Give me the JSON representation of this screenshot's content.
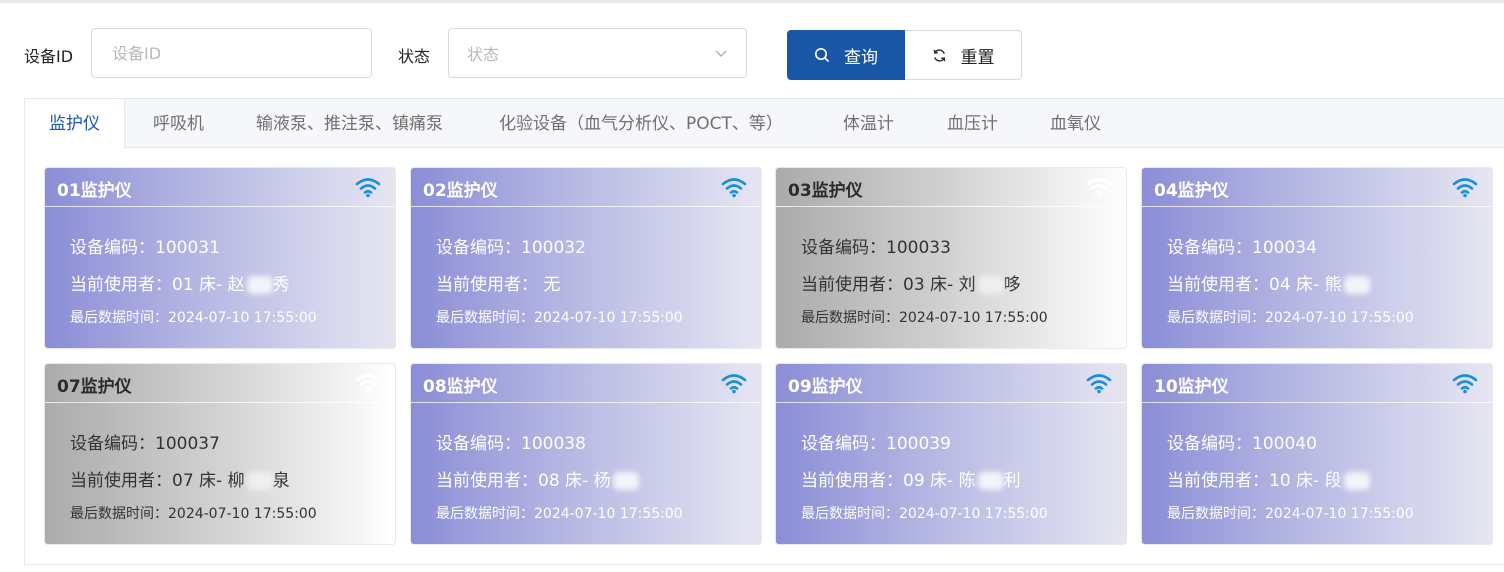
{
  "filters": {
    "device_id_label": "设备ID",
    "device_id_placeholder": "设备ID",
    "device_id_value": "",
    "status_label": "状态",
    "status_placeholder": "状态",
    "query_label": "查询",
    "reset_label": "重置"
  },
  "tabs": [
    {
      "label": "监护仪"
    },
    {
      "label": "呼吸机"
    },
    {
      "label": "输液泵、推注泵、镇痛泵"
    },
    {
      "label": "化验设备（血气分析仪、POCT、等）"
    },
    {
      "label": "体温计"
    },
    {
      "label": "血压计"
    },
    {
      "label": "血氧仪"
    }
  ],
  "active_tab": 0,
  "colors": {
    "primary": "#1a56a6",
    "wifi_online": "#1a8fd8",
    "wifi_offline": "#ffffff"
  },
  "cards": [
    {
      "title": "01监护仪",
      "status": "online",
      "code_line": "设备编码：100031",
      "user_line": "当前使用者：01 床- 赵",
      "user_tail": "秀",
      "time_line": "最后数据时间：2024-07-10 17:55:00"
    },
    {
      "title": "02监护仪",
      "status": "online",
      "code_line": "设备编码：100032",
      "user_line": "当前使用者：  无",
      "user_tail": "",
      "time_line": "最后数据时间：2024-07-10 17:55:00"
    },
    {
      "title": "03监护仪",
      "status": "offline",
      "code_line": "设备编码：100033",
      "user_line": "当前使用者：03 床- 刘",
      "user_tail": "哆",
      "time_line": "最后数据时间：2024-07-10 17:55:00"
    },
    {
      "title": "04监护仪",
      "status": "online",
      "code_line": "设备编码：100034",
      "user_line": "当前使用者：04 床- 熊",
      "user_tail": "",
      "time_line": "最后数据时间：2024-07-10 17:55:00"
    },
    {
      "title": "07监护仪",
      "status": "offline",
      "code_line": "设备编码：100037",
      "user_line": "当前使用者：07 床- 柳",
      "user_tail": "泉",
      "time_line": "最后数据时间：2024-07-10 17:55:00"
    },
    {
      "title": "08监护仪",
      "status": "online",
      "code_line": "设备编码：100038",
      "user_line": "当前使用者：08 床- 杨",
      "user_tail": "",
      "time_line": "最后数据时间：2024-07-10 17:55:00"
    },
    {
      "title": "09监护仪",
      "status": "online",
      "code_line": "设备编码：100039",
      "user_line": "当前使用者：09 床- 陈",
      "user_tail": "利",
      "time_line": "最后数据时间：2024-07-10 17:55:00"
    },
    {
      "title": "10监护仪",
      "status": "online",
      "code_line": "设备编码：100040",
      "user_line": "当前使用者：10 床- 段",
      "user_tail": "",
      "time_line": "最后数据时间：2024-07-10 17:55:00"
    }
  ]
}
